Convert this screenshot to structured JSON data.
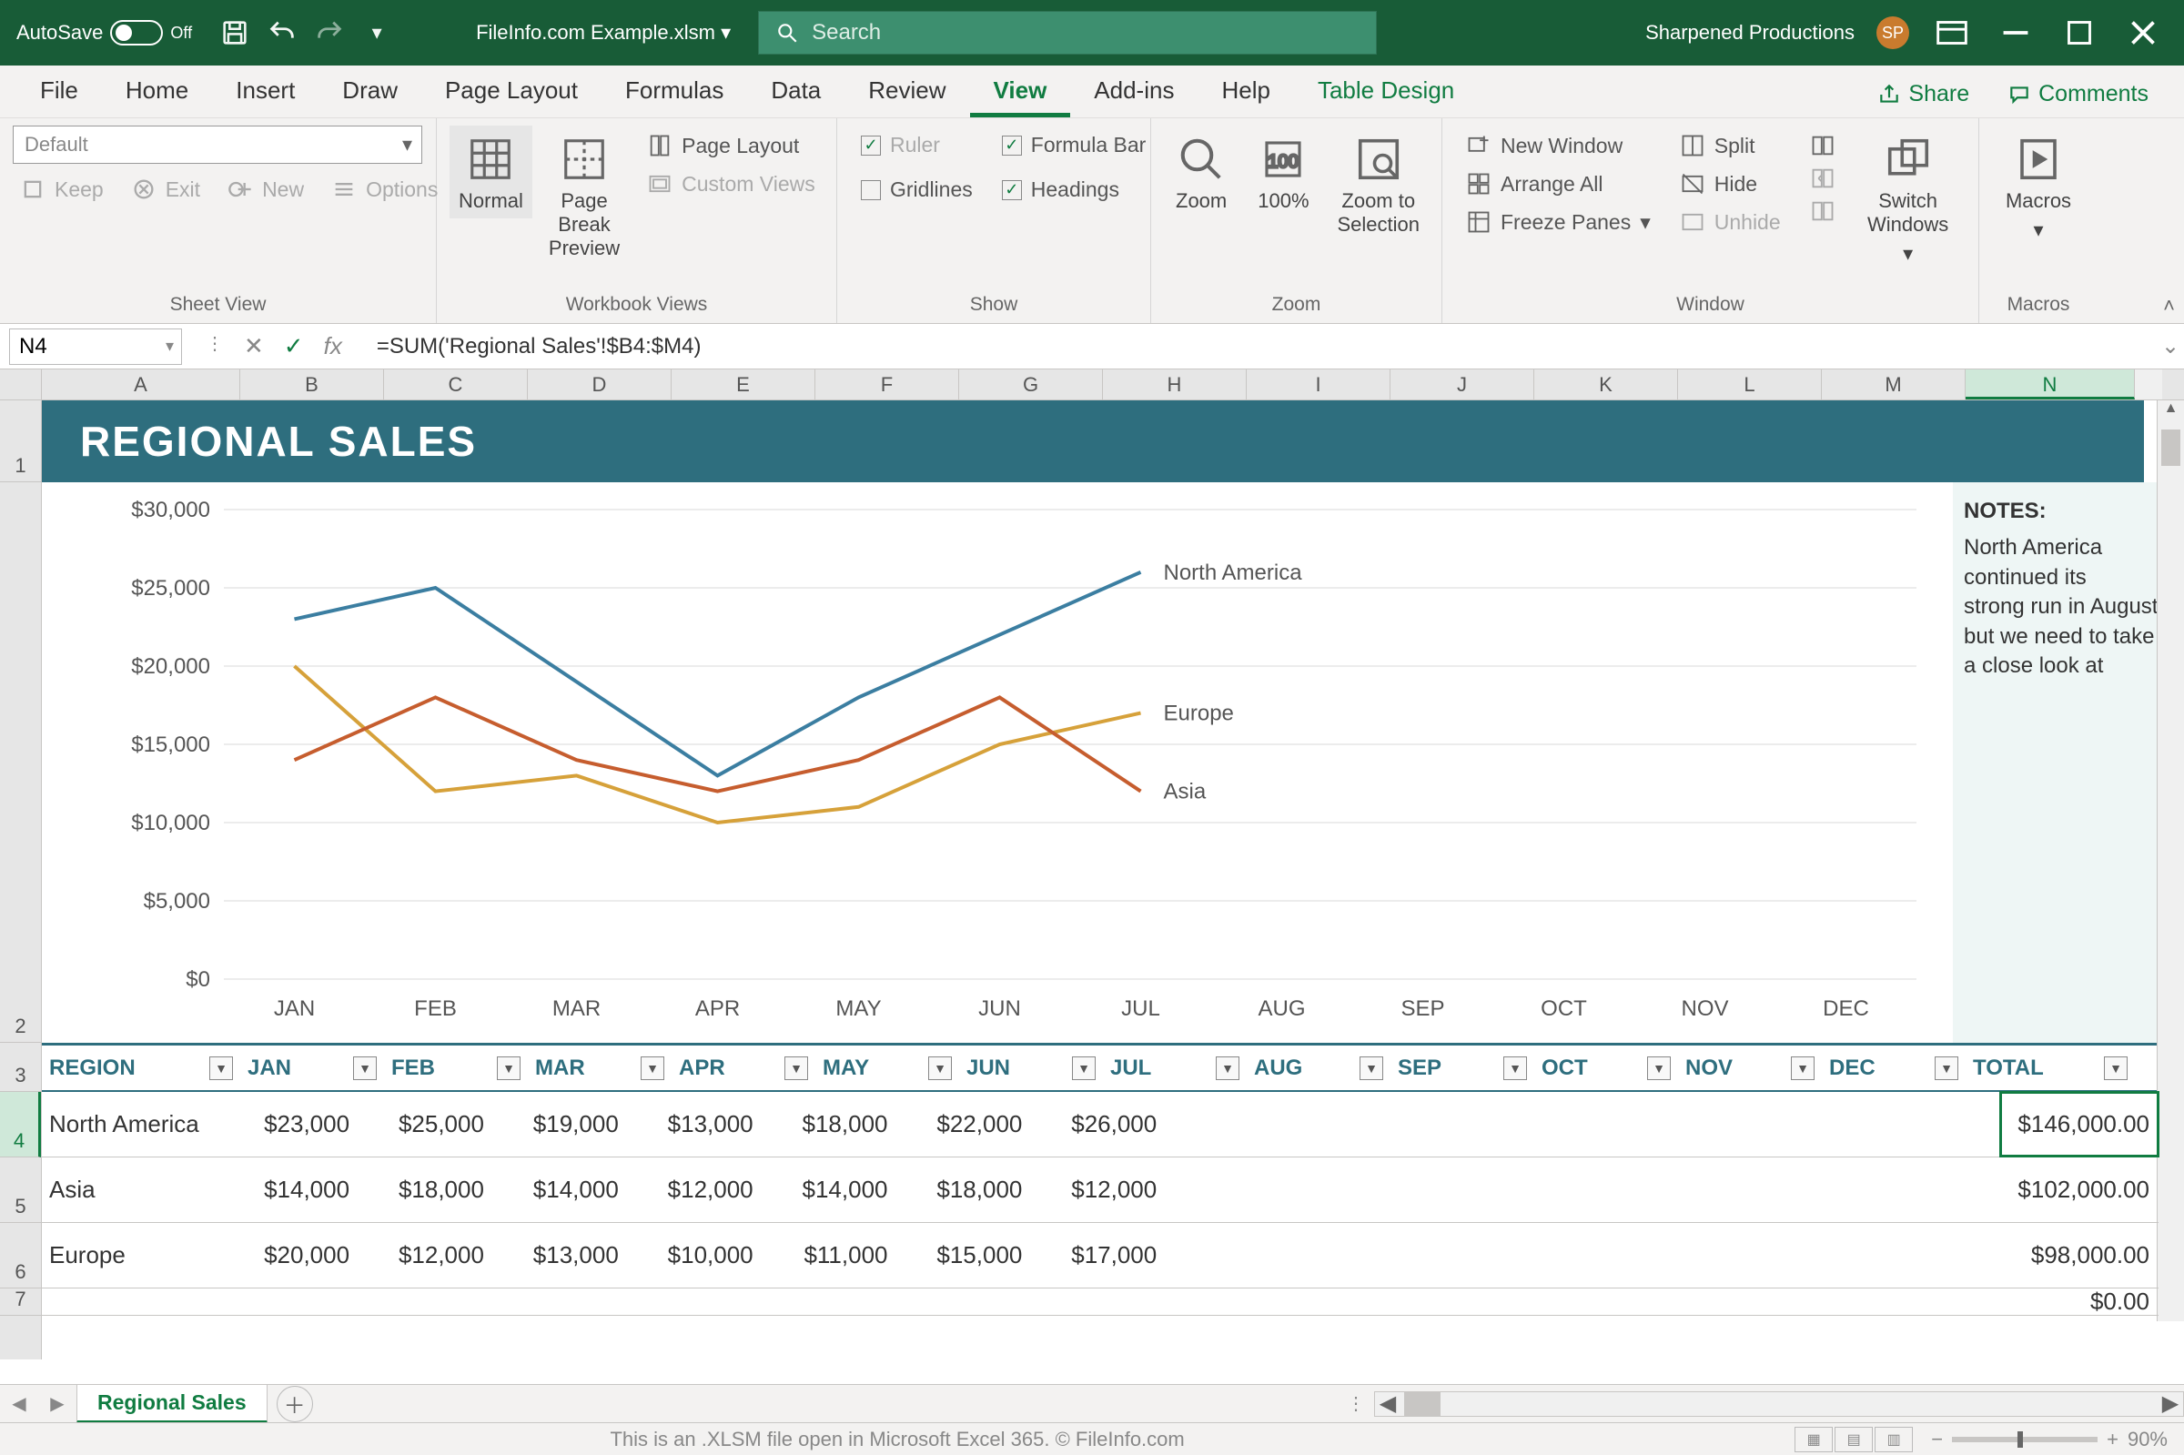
{
  "titlebar": {
    "autosave_label": "AutoSave",
    "autosave_state": "Off",
    "filename": "FileInfo.com Example.xlsm",
    "search_placeholder": "Search",
    "account": "Sharpened Productions",
    "account_initials": "SP"
  },
  "tabs": {
    "file": "File",
    "home": "Home",
    "insert": "Insert",
    "draw": "Draw",
    "page_layout": "Page Layout",
    "formulas": "Formulas",
    "data": "Data",
    "review": "Review",
    "view": "View",
    "addins": "Add-ins",
    "help": "Help",
    "table_design": "Table Design",
    "share": "Share",
    "comments": "Comments"
  },
  "ribbon": {
    "sheetview": {
      "default": "Default",
      "keep": "Keep",
      "exit": "Exit",
      "new": "New",
      "options": "Options",
      "label": "Sheet View"
    },
    "workbook": {
      "normal": "Normal",
      "page_break": "Page Break Preview",
      "page_layout": "Page Layout",
      "custom": "Custom Views",
      "label": "Workbook Views"
    },
    "show": {
      "ruler": "Ruler",
      "gridlines": "Gridlines",
      "formula_bar": "Formula Bar",
      "headings": "Headings",
      "label": "Show"
    },
    "zoom": {
      "zoom": "Zoom",
      "hundred": "100%",
      "selection": "Zoom to Selection",
      "label": "Zoom"
    },
    "window": {
      "new": "New Window",
      "arrange": "Arrange All",
      "freeze": "Freeze Panes",
      "split": "Split",
      "hide": "Hide",
      "unhide": "Unhide",
      "switch": "Switch Windows",
      "label": "Window"
    },
    "macros": {
      "macros": "Macros",
      "label": "Macros"
    }
  },
  "formulabar": {
    "cell": "N4",
    "formula": "=SUM('Regional Sales'!$B4:$M4)"
  },
  "columns": [
    "A",
    "B",
    "C",
    "D",
    "E",
    "F",
    "G",
    "H",
    "I",
    "J",
    "K",
    "L",
    "M",
    "N"
  ],
  "active_col": "N",
  "rows": [
    "1",
    "2",
    "3",
    "4",
    "5",
    "6",
    "7"
  ],
  "active_row": "4",
  "banner": "REGIONAL SALES",
  "notes": {
    "title": "NOTES:",
    "body": "North America continued its\nstrong run in August, but we need to take a close look at"
  },
  "table": {
    "headers": [
      "REGION",
      "JAN",
      "FEB",
      "MAR",
      "APR",
      "MAY",
      "JUN",
      "JUL",
      "AUG",
      "SEP",
      "OCT",
      "NOV",
      "DEC",
      "TOTAL"
    ],
    "rows": [
      {
        "region": "North America",
        "vals": [
          "$23,000",
          "$25,000",
          "$19,000",
          "$13,000",
          "$18,000",
          "$22,000",
          "$26,000",
          "",
          "",
          "",
          "",
          "",
          ""
        ],
        "total": "$146,000.00"
      },
      {
        "region": "Asia",
        "vals": [
          "$14,000",
          "$18,000",
          "$14,000",
          "$12,000",
          "$14,000",
          "$18,000",
          "$12,000",
          "",
          "",
          "",
          "",
          "",
          ""
        ],
        "total": "$102,000.00"
      },
      {
        "region": "Europe",
        "vals": [
          "$20,000",
          "$12,000",
          "$13,000",
          "$10,000",
          "$11,000",
          "$15,000",
          "$17,000",
          "",
          "",
          "",
          "",
          "",
          ""
        ],
        "total": "$98,000.00"
      },
      {
        "region": "",
        "vals": [
          "",
          "",
          "",
          "",
          "",
          "",
          "",
          "",
          "",
          "",
          "",
          "",
          ""
        ],
        "total": "$0.00"
      }
    ]
  },
  "sheet_tab": "Regional Sales",
  "status": {
    "caption": "This is an .XLSM file open in Microsoft Excel 365. © FileInfo.com",
    "zoom": "90%"
  },
  "chart_data": {
    "type": "line",
    "categories": [
      "JAN",
      "FEB",
      "MAR",
      "APR",
      "MAY",
      "JUN",
      "JUL",
      "AUG",
      "SEP",
      "OCT",
      "NOV",
      "DEC"
    ],
    "series": [
      {
        "name": "North America",
        "color": "#3b7ea1",
        "values": [
          23000,
          25000,
          19000,
          13000,
          18000,
          22000,
          26000,
          null,
          null,
          null,
          null,
          null
        ]
      },
      {
        "name": "Europe",
        "color": "#d6a13a",
        "values": [
          20000,
          12000,
          13000,
          10000,
          11000,
          15000,
          17000,
          null,
          null,
          null,
          null,
          null
        ]
      },
      {
        "name": "Asia",
        "color": "#c65d2e",
        "values": [
          14000,
          18000,
          14000,
          12000,
          14000,
          18000,
          12000,
          null,
          null,
          null,
          null,
          null
        ]
      }
    ],
    "ylabel": "",
    "xlabel": "",
    "ylim": [
      0,
      30000
    ],
    "yticks": [
      0,
      5000,
      10000,
      15000,
      20000,
      25000,
      30000
    ],
    "ytick_labels": [
      "$0",
      "$5,000",
      "$10,000",
      "$15,000",
      "$20,000",
      "$25,000",
      "$30,000"
    ]
  }
}
